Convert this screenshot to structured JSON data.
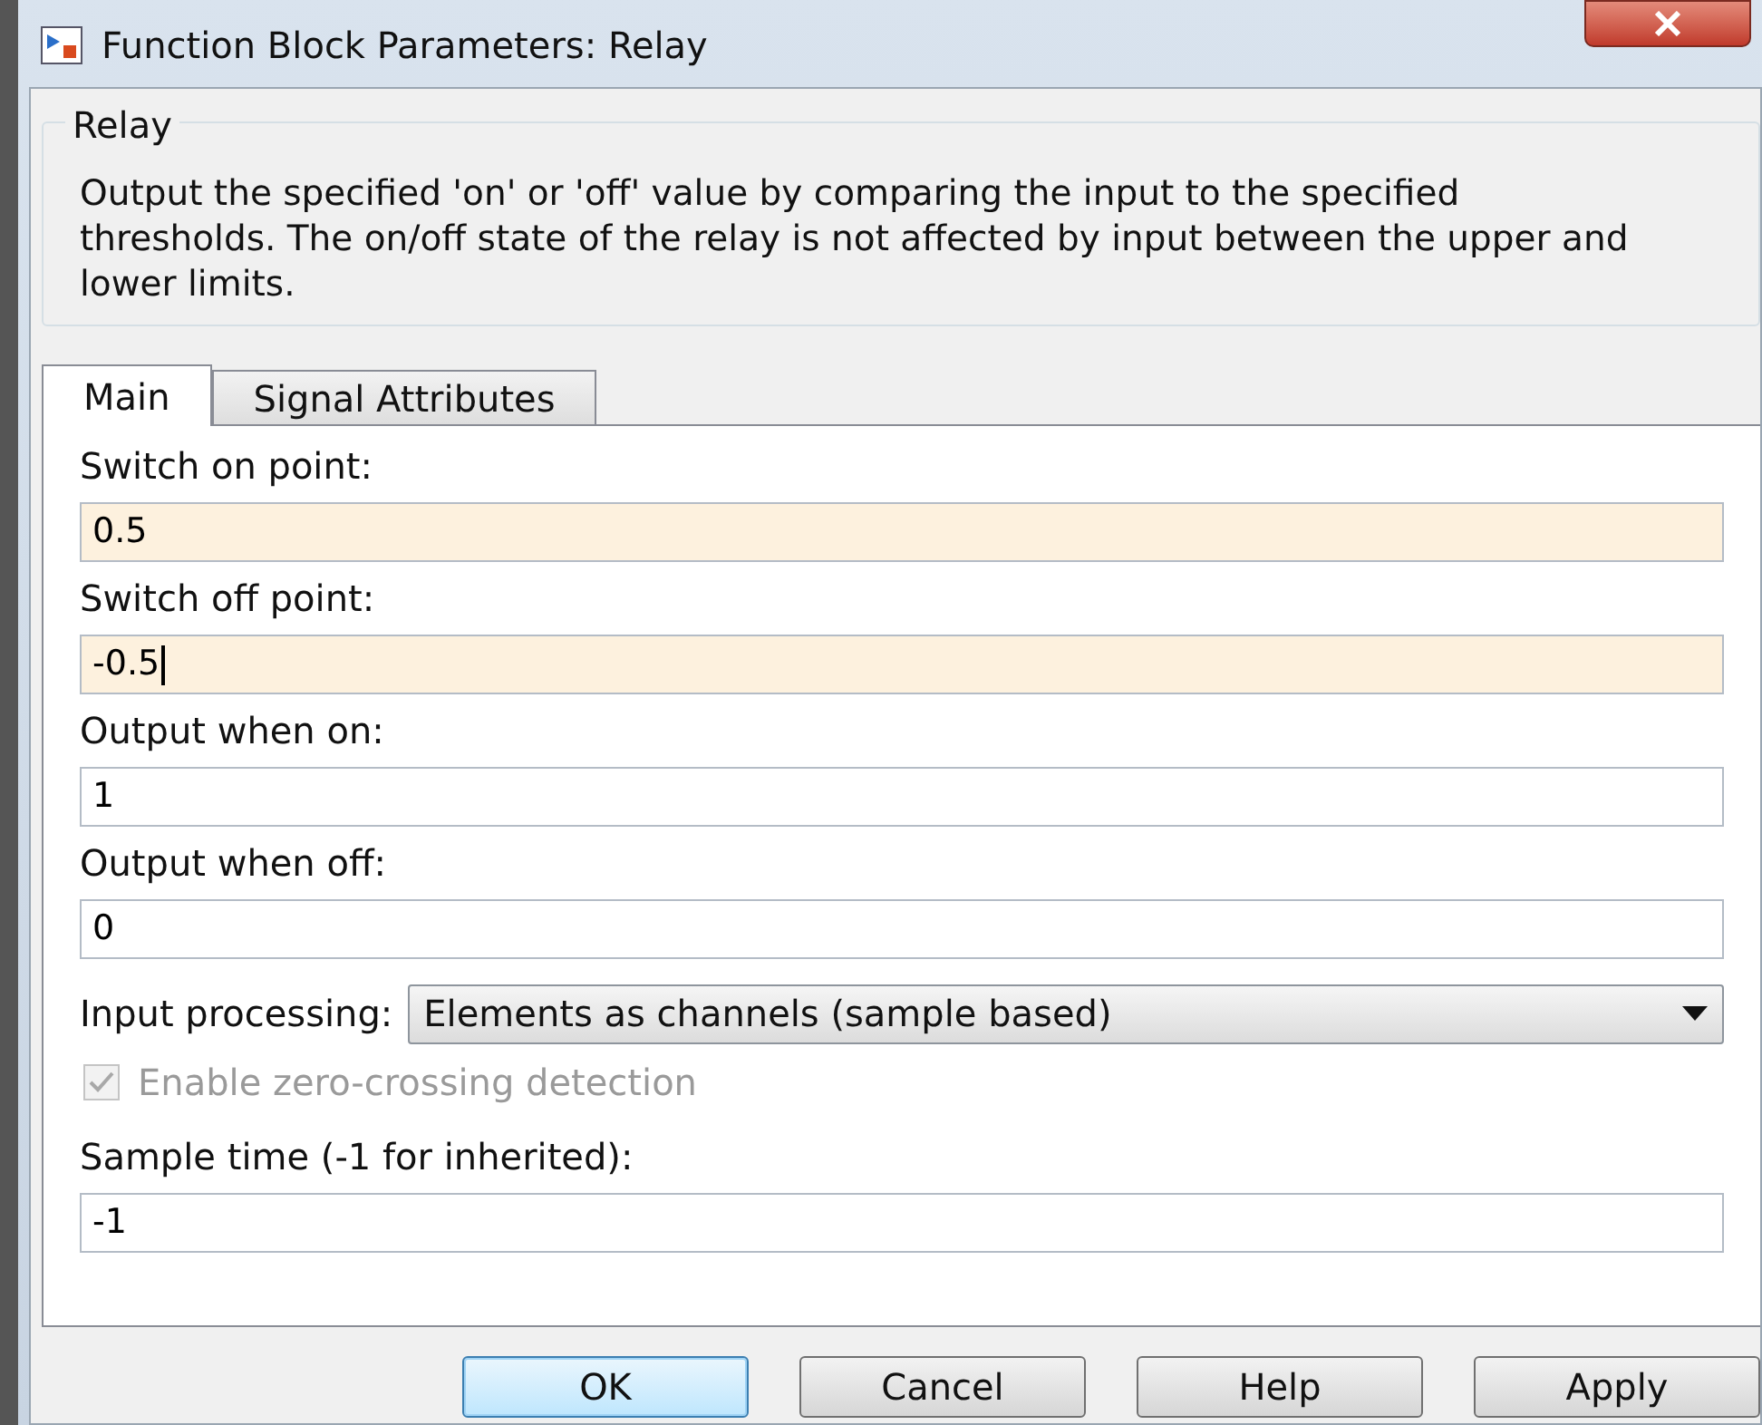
{
  "window": {
    "title": "Function Block Parameters: Relay"
  },
  "group": {
    "title": "Relay",
    "description": "Output the specified 'on' or 'off' value by comparing the input to the specified thresholds.  The on/off state of the relay is not affected by input between the upper and lower limits."
  },
  "tabs": [
    {
      "label": "Main",
      "selected": true
    },
    {
      "label": "Signal Attributes",
      "selected": false
    }
  ],
  "parameters": [
    {
      "kind": "field",
      "label": "Switch on point:",
      "value": "0.5",
      "highlighted": true,
      "caret": false
    },
    {
      "kind": "field",
      "label": "Switch off point:",
      "value": "-0.5",
      "highlighted": true,
      "caret": true
    },
    {
      "kind": "field",
      "label": "Output when on:",
      "value": "1",
      "highlighted": false,
      "caret": false
    },
    {
      "kind": "field",
      "label": "Output when off:",
      "value": "0",
      "highlighted": false,
      "caret": false
    },
    {
      "kind": "dropdown",
      "label": "Input processing:",
      "value": "Elements as channels (sample based)"
    },
    {
      "kind": "checkbox",
      "label": "Enable zero-crossing detection",
      "checked": true,
      "disabled": true
    },
    {
      "kind": "field",
      "label": "Sample time (-1 for inherited):",
      "value": "-1",
      "highlighted": false,
      "caret": false
    }
  ],
  "buttons": [
    {
      "label": "OK",
      "focused": true
    },
    {
      "label": "Cancel",
      "focused": false
    },
    {
      "label": "Help",
      "focused": false
    },
    {
      "label": "Apply",
      "focused": false
    }
  ]
}
